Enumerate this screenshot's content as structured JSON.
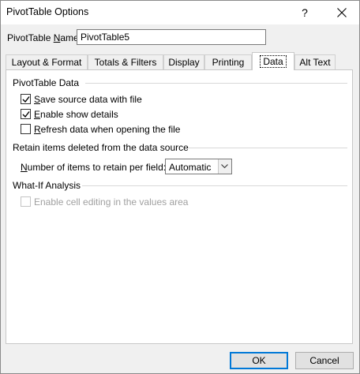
{
  "window": {
    "title": "PivotTable Options",
    "help_label": "?"
  },
  "name_field": {
    "label_prefix": "PivotTable ",
    "label_accel": "N",
    "label_suffix": "ame:",
    "value": "PivotTable5"
  },
  "tabs": [
    {
      "label": "Layout & Format",
      "active": false
    },
    {
      "label": "Totals & Filters",
      "active": false
    },
    {
      "label": "Display",
      "active": false
    },
    {
      "label": "Printing",
      "active": false
    },
    {
      "label": "Data",
      "active": true
    },
    {
      "label": "Alt Text",
      "active": false
    }
  ],
  "data_tab": {
    "pivot_section": {
      "title": "PivotTable Data",
      "options": [
        {
          "accel": "S",
          "rest": "ave source data with file",
          "checked": true,
          "enabled": true
        },
        {
          "accel": "E",
          "rest": "nable show details",
          "checked": true,
          "enabled": true
        },
        {
          "accel": "R",
          "rest": "efresh data when opening the file",
          "checked": false,
          "enabled": true
        }
      ]
    },
    "retain_section": {
      "title": "Retain items deleted from the data source",
      "label_accel": "N",
      "label_rest": "umber of items to retain per field:",
      "selected": "Automatic"
    },
    "whatif_section": {
      "title": "What-If Analysis",
      "option": {
        "label": "Enable cell editing in the values area",
        "checked": false,
        "enabled": false
      }
    }
  },
  "buttons": {
    "ok": "OK",
    "cancel": "Cancel"
  },
  "colors": {
    "accent": "#0078d7",
    "dialog_bg": "#f0f0f0",
    "panel_bg": "#ffffff",
    "disabled_text": "#a0a0a0"
  }
}
